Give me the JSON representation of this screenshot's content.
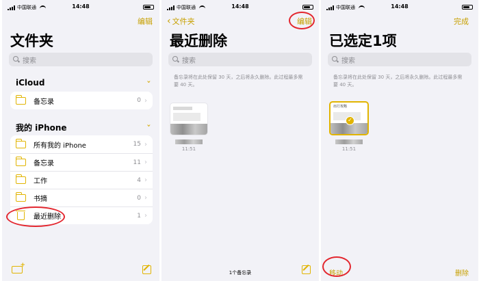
{
  "status_bar": {
    "carrier": "中国联通",
    "time": "14:48"
  },
  "screen1": {
    "edit": "编辑",
    "title": "文件夹",
    "search_placeholder": "搜索",
    "sections": [
      {
        "name": "iCloud",
        "rows": [
          {
            "label": "备忘录",
            "count": "0"
          }
        ]
      },
      {
        "name": "我的 iPhone",
        "rows": [
          {
            "label": "所有我的 iPhone",
            "count": "15"
          },
          {
            "label": "备忘录",
            "count": "11"
          },
          {
            "label": "工作",
            "count": "4"
          },
          {
            "label": "书摘",
            "count": "0"
          },
          {
            "label": "最近删除",
            "count": "1"
          }
        ]
      }
    ],
    "icons": {
      "new_folder": "folder-plus-icon",
      "compose": "compose-icon"
    }
  },
  "screen2": {
    "back": "文件夹",
    "edit": "编辑",
    "title": "最近删除",
    "search_placeholder": "搜索",
    "hint": "备忘录将在此处保留 30 天，之后将永久删除。此过程最多需要 40 天。",
    "note_time": "11:51",
    "footer": "1个备忘录"
  },
  "screen3": {
    "done": "完成",
    "title": "已选定1项",
    "search_placeholder": "搜索",
    "hint": "备忘录将在此处保留 30 天，之后将永久删除。此过程最多需要 40 天。",
    "note_title": "出行攻略",
    "note_time": "11:51",
    "move": "移动",
    "delete": "删除"
  },
  "colors": {
    "accent": "#e1b400",
    "highlight_ring": "#e3262e",
    "background": "#f2f2f7"
  }
}
